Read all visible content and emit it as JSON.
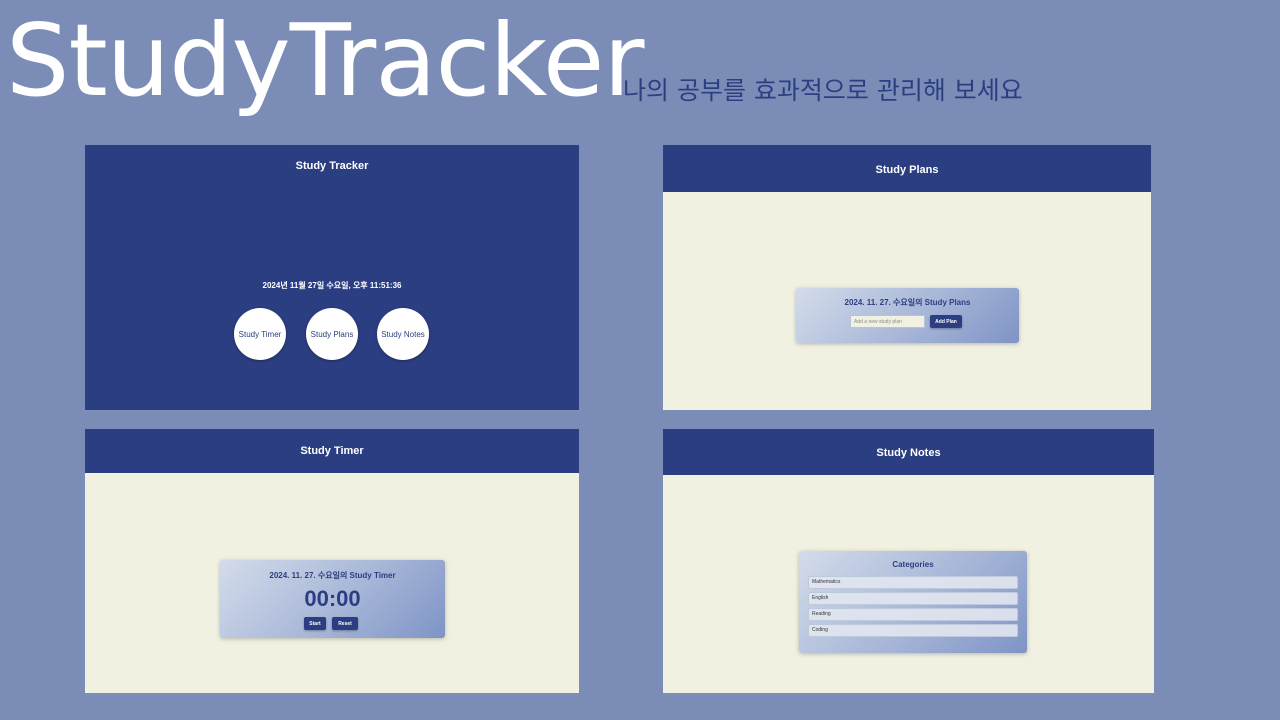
{
  "hero": {
    "title": "StudyTracker",
    "subtitle": "나의 공부를 효과적으로 관리해 보세요"
  },
  "home": {
    "title": "Study Tracker",
    "datetime": "2024년 11월 27일 수요일, 오후 11:51:36",
    "buttons": [
      "Study Timer",
      "Study Plans",
      "Study Notes"
    ]
  },
  "plans": {
    "header": "Study Plans",
    "card_title": "2024. 11. 27. 수요일의 Study Plans",
    "input_placeholder": "Add a new study plan",
    "input_value": "",
    "add_button": "Add Plan"
  },
  "timer": {
    "header": "Study Timer",
    "card_title": "2024. 11. 27. 수요일의 Study Timer",
    "display": "00:00",
    "start_button": "Start",
    "reset_button": "Reset"
  },
  "notes": {
    "header": "Study Notes",
    "card_title": "Categories",
    "categories": [
      "Mathematics",
      "English",
      "Reading",
      "Coding"
    ]
  },
  "colors": {
    "background": "#7b8db7",
    "primary": "#2c3e82",
    "panel_body": "#f1f1e2",
    "white": "#ffffff"
  }
}
